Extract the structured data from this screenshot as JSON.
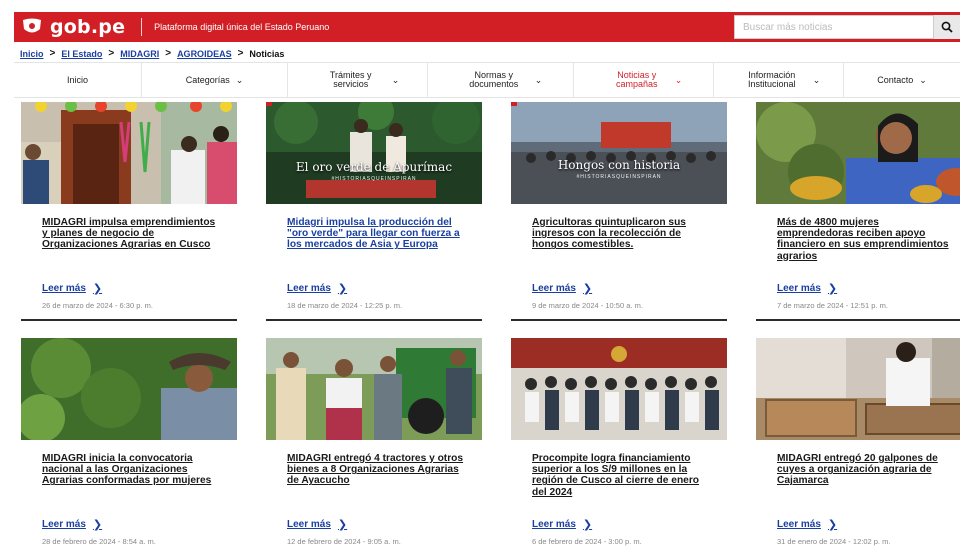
{
  "header": {
    "logo_text": "gob.pe",
    "tagline": "Plataforma digital única del Estado Peruano",
    "search_placeholder": "Buscar más noticias",
    "brand_color": "#d21f26"
  },
  "breadcrumb": {
    "items": [
      "Inicio",
      "El Estado",
      "MIDAGRI",
      "AGROIDEAS"
    ],
    "current": "Noticias",
    "separator": ">"
  },
  "nav": {
    "items": [
      {
        "label": "Inicio",
        "has_dropdown": false
      },
      {
        "label": "Categorías",
        "has_dropdown": true
      },
      {
        "label": "Trámites y servicios",
        "has_dropdown": true
      },
      {
        "label": "Normas y documentos",
        "has_dropdown": true
      },
      {
        "label": "Noticias y campañas",
        "has_dropdown": true,
        "active": true
      },
      {
        "label": "Información Institucional",
        "has_dropdown": true
      },
      {
        "label": "Contacto",
        "has_dropdown": true
      }
    ]
  },
  "cards": [
    {
      "title": "MIDAGRI impulsa emprendimientos y planes de negocio de Organizaciones Agrarias en Cusco",
      "more": "Leer más",
      "date": "26 de marzo de 2024 - 6:30 p. m.",
      "title_color": "dark",
      "image": "photo-festive-doorway"
    },
    {
      "title": "Midagri impulsa la producción del \"oro verde\" para llegar con fuerza a los mercados de Asia y Europa",
      "more": "Leer más",
      "date": "18 de marzo de 2024 - 12:25 p. m.",
      "title_color": "blue",
      "image": "photo-avocado-farmers",
      "overlay": "El oro verde de Apurímac",
      "overlay_sub": "#HISTORIASQUEINSPIRAN"
    },
    {
      "title": "Agricultoras quintuplicaron sus ingresos con la recolección de hongos comestibles.",
      "more": "Leer más",
      "date": "9 de marzo de 2024 - 10:50 a. m.",
      "title_color": "dark",
      "image": "photo-mushroom-group",
      "overlay": "Hongos con historia",
      "overlay_sub": "#HISTORIASQUEINSPIRAN"
    },
    {
      "title": "Más de 4800 mujeres emprendedoras reciben apoyo financiero en sus emprendimientos agrarios",
      "more": "Leer más",
      "date": "7 de marzo de 2024 - 12:51 p. m.",
      "title_color": "dark",
      "image": "photo-woman-cacao"
    },
    {
      "title": "MIDAGRI inicia la convocatoria nacional a las Organizaciones Agrarias conformadas por mujeres",
      "more": "Leer más",
      "date": "28 de febrero de 2024 - 8:54 a. m.",
      "title_color": "dark",
      "image": "photo-woman-plants"
    },
    {
      "title": "MIDAGRI entregó 4 tractores y otros bienes a 8 Organizaciones Agrarias de Ayacucho",
      "more": "Leer más",
      "date": "12 de febrero de 2024 - 9:05 a. m.",
      "title_color": "dark",
      "image": "photo-tractor-people"
    },
    {
      "title": "Procompite logra financiamiento superior a los S/9 millones en la región de Cusco al cierre de enero del 2024",
      "more": "Leer más",
      "date": "6 de febrero de 2024 - 3:00 p. m.",
      "title_color": "dark",
      "image": "photo-group-building"
    },
    {
      "title": "MIDAGRI entregó 20 galpones de cuyes a organización agraria de Cajamarca",
      "more": "Leer más",
      "date": "31 de enero de 2024 - 12:02 p. m.",
      "title_color": "dark",
      "image": "photo-guinea-pig-cages"
    }
  ]
}
